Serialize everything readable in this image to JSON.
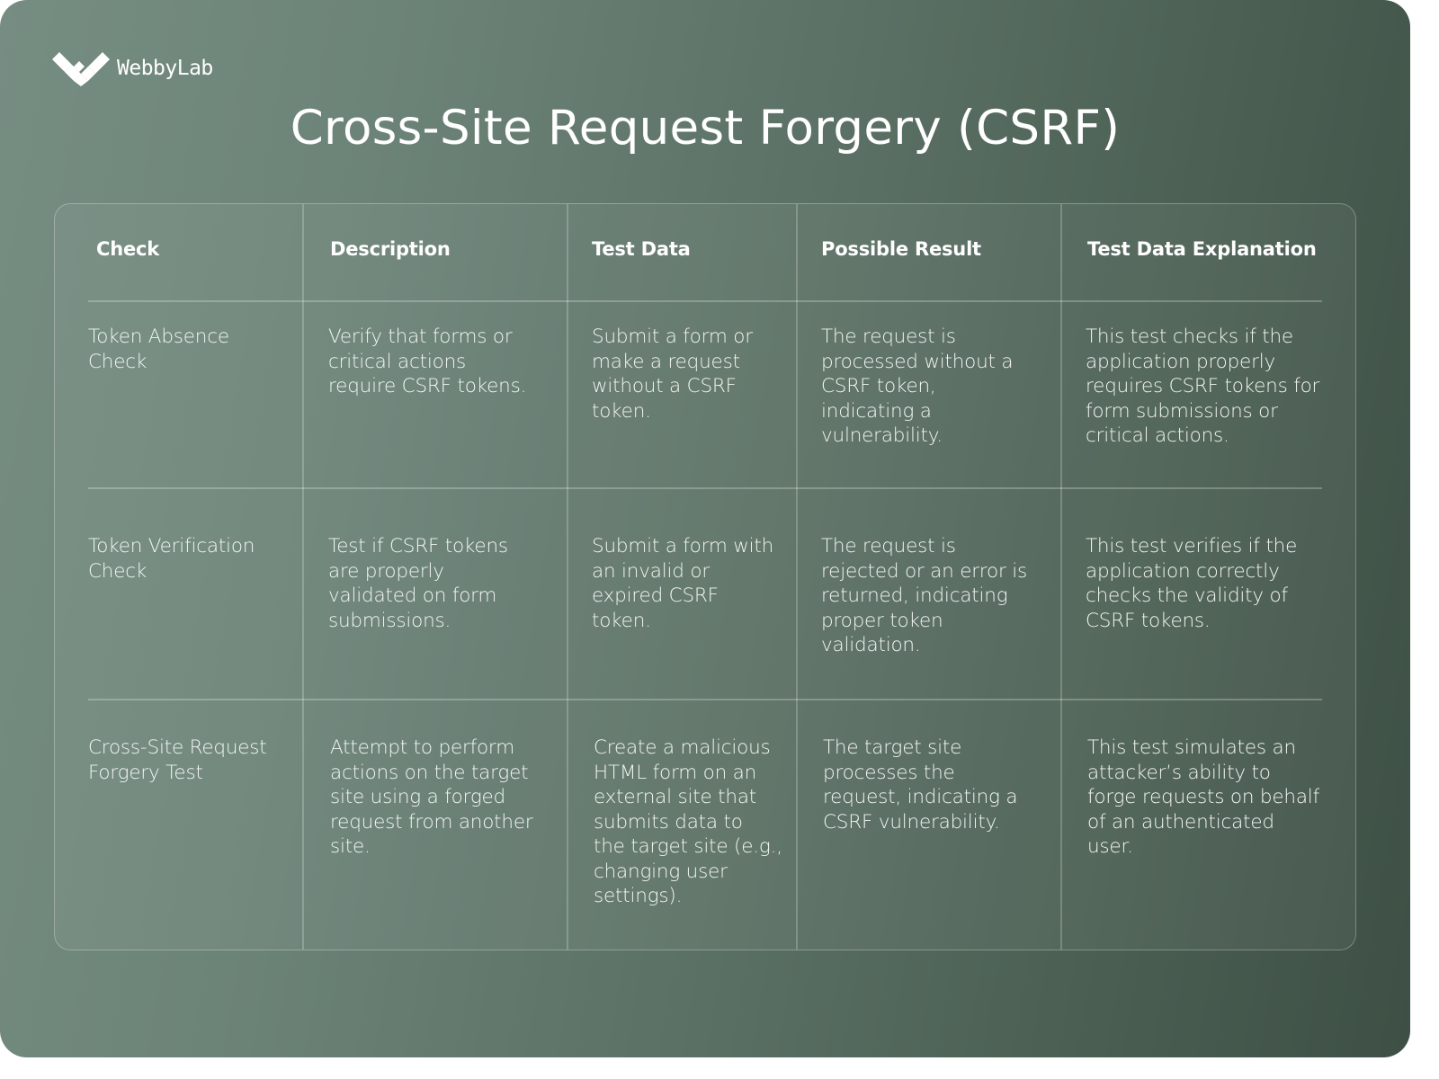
{
  "brand": {
    "logo_icon": "webbylab-logo-icon",
    "name": "WebbyLab"
  },
  "title": "Cross-Site Request Forgery (CSRF)",
  "colors": {
    "background_light": "#768d82",
    "background_dark": "#3e5045",
    "text": "#ffffff"
  },
  "table": {
    "headers": [
      "Check",
      "Description",
      "Test Data",
      "Possible Result",
      "Test Data Explanation"
    ],
    "rows": [
      {
        "check": "Token Absence\nCheck",
        "description": "Verify that forms or\ncritical actions\nrequire CSRF tokens.",
        "test_data": "Submit a form or\nmake a request\nwithout a CSRF\ntoken.",
        "possible_result": "The request is\nprocessed without a\nCSRF token,\nindicating a\nvulnerability.",
        "explanation": "This test checks if the\napplication properly\nrequires CSRF tokens for\nform submissions or\ncritical actions."
      },
      {
        "check": "Token Verification\nCheck",
        "description": "Test if CSRF tokens\nare properly\nvalidated on form\nsubmissions.",
        "test_data": "Submit a form with\nan invalid or\nexpired CSRF\ntoken.",
        "possible_result": "The request is\nrejected or an error is\nreturned, indicating\nproper token\nvalidation.",
        "explanation": "This test verifies if the\napplication correctly\nchecks the validity of\nCSRF tokens."
      },
      {
        "check": "Cross-Site Request\nForgery Test",
        "description": "Attempt to perform\nactions on the target\nsite using a forged\nrequest from another\nsite.",
        "test_data": "Create a malicious\nHTML form on an\nexternal site that\nsubmits data to\nthe target site (e.g.,\nchanging user\nsettings).",
        "possible_result": "The target site\nprocesses the\nrequest, indicating a\nCSRF vulnerability.",
        "explanation": "This test simulates an\nattacker’s ability to\nforge requests on behalf\nof an authenticated\nuser."
      }
    ]
  }
}
